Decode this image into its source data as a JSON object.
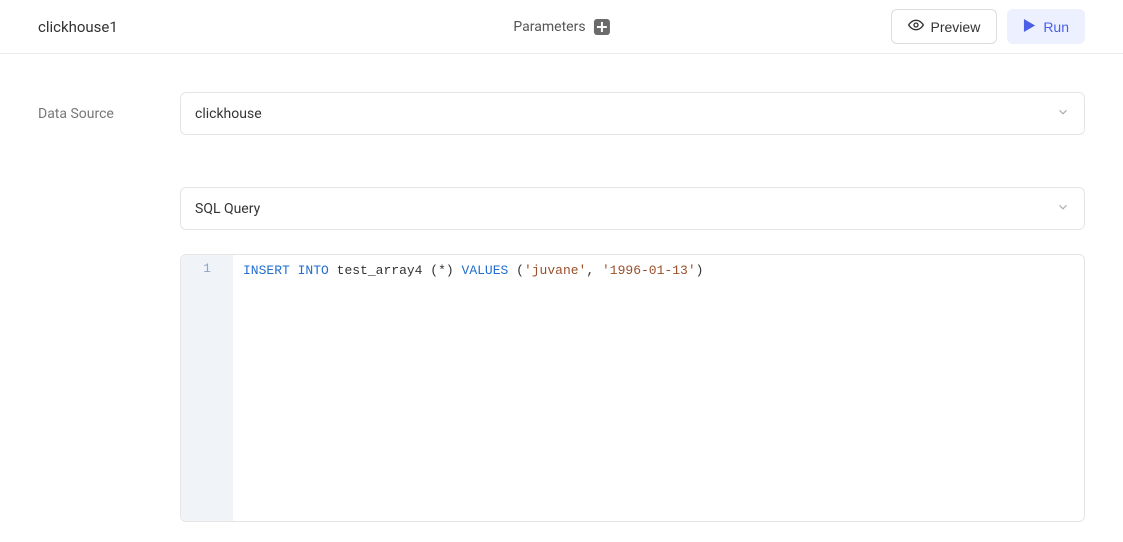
{
  "header": {
    "title": "clickhouse1",
    "parameters_label": "Parameters",
    "preview_label": "Preview",
    "run_label": "Run"
  },
  "form": {
    "datasource_label": "Data Source",
    "datasource_value": "clickhouse",
    "query_type_value": "SQL Query"
  },
  "editor": {
    "line_numbers": [
      "1"
    ],
    "sql": {
      "tokens": [
        {
          "t": "kw",
          "v": "INSERT"
        },
        {
          "t": "sp",
          "v": " "
        },
        {
          "t": "kw",
          "v": "INTO"
        },
        {
          "t": "sp",
          "v": " "
        },
        {
          "t": "ident",
          "v": "test_array4"
        },
        {
          "t": "sp",
          "v": " "
        },
        {
          "t": "punct",
          "v": "(*)"
        },
        {
          "t": "sp",
          "v": " "
        },
        {
          "t": "kw",
          "v": "VALUES"
        },
        {
          "t": "sp",
          "v": " "
        },
        {
          "t": "punct",
          "v": "("
        },
        {
          "t": "str",
          "v": "'juvane'"
        },
        {
          "t": "punct",
          "v": ","
        },
        {
          "t": "sp",
          "v": " "
        },
        {
          "t": "str",
          "v": "'1996-01-13'"
        },
        {
          "t": "punct",
          "v": ")"
        }
      ]
    }
  }
}
